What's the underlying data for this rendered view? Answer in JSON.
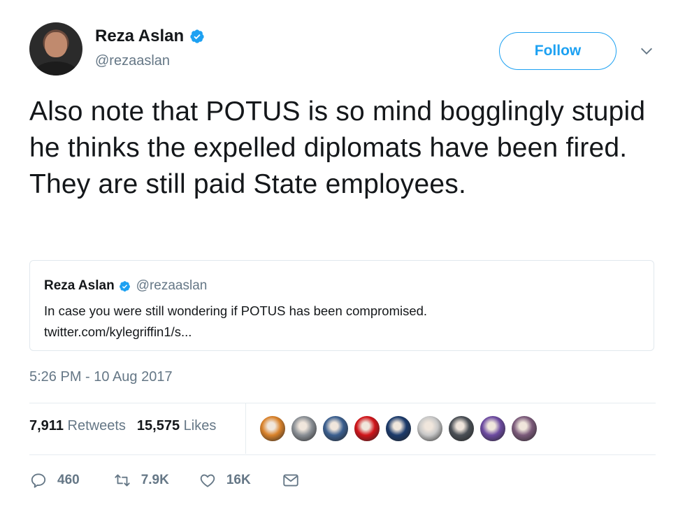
{
  "author": {
    "name": "Reza Aslan",
    "handle": "@rezaaslan",
    "verified": true
  },
  "follow_button": {
    "label": "Follow"
  },
  "tweet": {
    "text": "Also note that POTUS is so mind bogglingly stupid he thinks the expelled diplomats have been fired. They are still paid State employees."
  },
  "quoted_tweet": {
    "name": "Reza Aslan",
    "handle": "@rezaaslan",
    "text_line1": "In case you were still wondering if POTUS has been compromised.",
    "text_line2": "twitter.com/kylegriffin1/s..."
  },
  "timestamp": "5:26 PM - 10 Aug 2017",
  "stats": {
    "retweets_count": "7,911",
    "retweets_label": "Retweets",
    "likes_count": "15,575",
    "likes_label": "Likes"
  },
  "liker_avatars": [
    {
      "icon": "avatar-1",
      "color": "#d9822b"
    },
    {
      "icon": "avatar-2",
      "color": "#8a8f95"
    },
    {
      "icon": "avatar-3",
      "color": "#3b5f8f"
    },
    {
      "icon": "avatar-4",
      "color": "#d0141a"
    },
    {
      "icon": "avatar-5",
      "color": "#1b3a6b"
    },
    {
      "icon": "avatar-6",
      "color": "#c8c8c8"
    },
    {
      "icon": "avatar-7",
      "color": "#4a4f55"
    },
    {
      "icon": "avatar-8",
      "color": "#6c4aa0"
    },
    {
      "icon": "avatar-9",
      "color": "#7b5a7a"
    }
  ],
  "actions": {
    "reply_count": "460",
    "retweet_count": "7.9K",
    "like_count": "16K"
  },
  "colors": {
    "accent": "#1da1f2",
    "secondary_text": "#657786",
    "border": "#e1e8ed"
  }
}
